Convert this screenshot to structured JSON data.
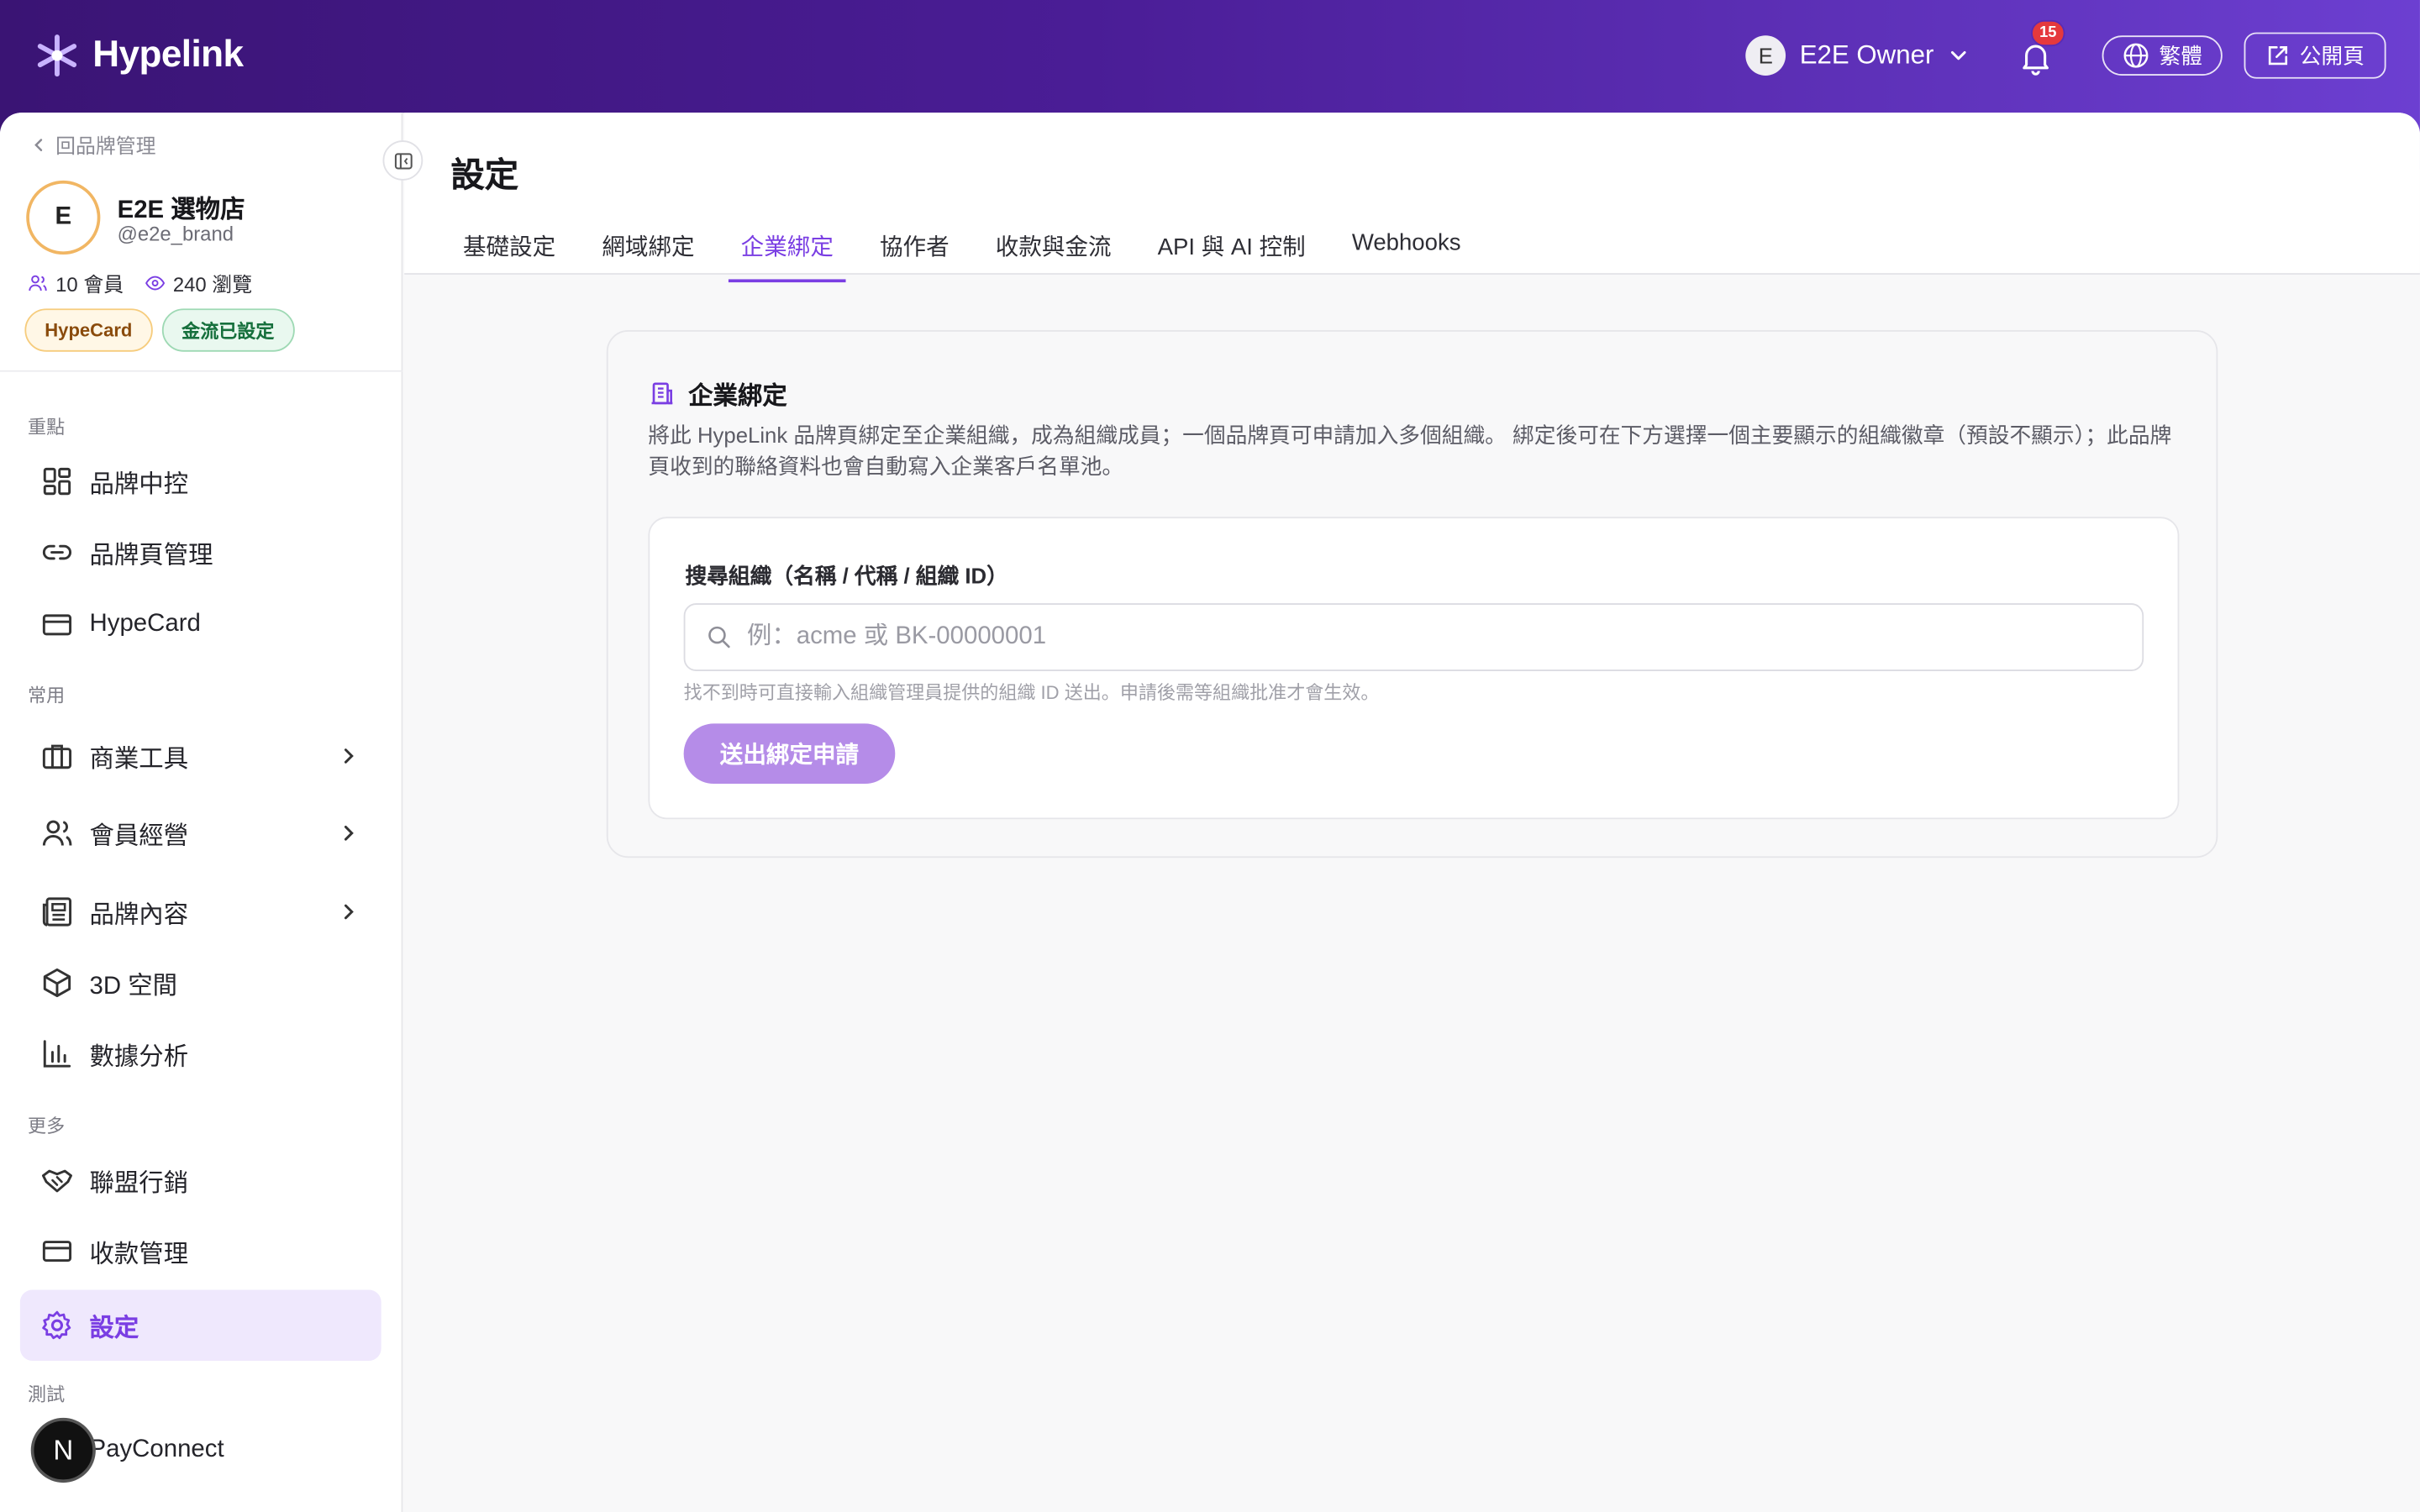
{
  "app": {
    "logo_text": "Hypelink"
  },
  "header": {
    "user_initial": "E",
    "user_name": "E2E Owner",
    "notification_count": "15",
    "language_label": "繁體",
    "public_page_label": "公開頁"
  },
  "sidebar": {
    "back_label": "回品牌管理",
    "brand": {
      "initial": "E",
      "name": "E2E 選物店",
      "handle": "@e2e_brand",
      "members": "10 會員",
      "views": "240 瀏覽",
      "tags": [
        "HypeCard",
        "金流已設定"
      ]
    },
    "sections": {
      "highlights": "重點",
      "common": "常用",
      "more": "更多",
      "test": "測試"
    },
    "items": {
      "brand_center": "品牌中控",
      "brand_pages": "品牌頁管理",
      "hypecard": "HypeCard",
      "business_tools": "商業工具",
      "member_ops": "會員經營",
      "brand_content": "品牌內容",
      "space_3d": "3D 空間",
      "analytics": "數據分析",
      "affiliate": "聯盟行銷",
      "payments": "收款管理",
      "settings": "設定",
      "payconnect": "PayConnect"
    },
    "fab_label": "N"
  },
  "main": {
    "title": "設定",
    "tabs": [
      "基礎設定",
      "網域綁定",
      "企業綁定",
      "協作者",
      "收款與金流",
      "API 與 AI 控制",
      "Webhooks"
    ],
    "active_tab": "企業綁定"
  },
  "card": {
    "title": "企業綁定",
    "description": "將此 HypeLink 品牌頁綁定至企業組織，成為組織成員；一個品牌頁可申請加入多個組織。 綁定後可在下方選擇一個主要顯示的組織徽章（預設不顯示）；此品牌頁收到的聯絡資料也會自動寫入企業客戶名單池。",
    "search_label": "搜尋組織（名稱 / 代稱 / 組織 ID）",
    "search_placeholder": "例：acme 或 BK-00000001",
    "search_value": "",
    "hint": "找不到時可直接輸入組織管理員提供的組織 ID 送出。申請後需等組織批准才會生效。",
    "submit_label": "送出綁定申請"
  },
  "colors": {
    "accent": "#7a3ee3",
    "header_start": "#3a1474",
    "header_end": "#6c3fd1",
    "submit_bg": "#b58ce8",
    "badge_red": "#e5393d"
  }
}
